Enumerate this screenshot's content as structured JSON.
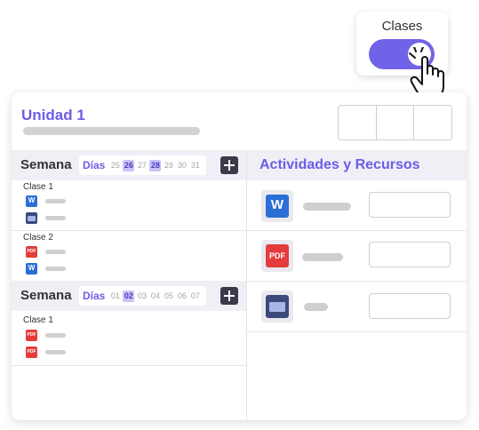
{
  "toggle": {
    "label": "Clases",
    "state": "on",
    "accent_color": "#7163e7"
  },
  "unit": {
    "title": "Unidad 1"
  },
  "weeks": [
    {
      "label": "Semana",
      "days_label": "Días",
      "days": [
        "25",
        "26",
        "27",
        "28",
        "29",
        "30",
        "31"
      ],
      "highlighted_days": [
        "26",
        "28"
      ],
      "classes": [
        {
          "label": "Clase 1",
          "resources": [
            "word-icon",
            "web-icon"
          ]
        },
        {
          "label": "Clase 2",
          "resources": [
            "pdf-icon",
            "word-icon"
          ]
        }
      ]
    },
    {
      "label": "Semana",
      "days_label": "Días",
      "days": [
        "01",
        "02",
        "03",
        "04",
        "05",
        "06",
        "07"
      ],
      "highlighted_days": [
        "02"
      ],
      "classes": [
        {
          "label": "Clase 1",
          "resources": [
            "pdf-icon",
            "pdf-icon"
          ]
        }
      ]
    }
  ],
  "activities": {
    "title": "Actividades y Recursos",
    "items": [
      {
        "icon": "word-icon",
        "icon_text": "W"
      },
      {
        "icon": "pdf-icon",
        "icon_text": "PDF"
      },
      {
        "icon": "web-icon",
        "icon_text": ""
      }
    ]
  },
  "icon_text": {
    "word": "W",
    "pdf": "PDF"
  },
  "colors": {
    "brand": "#6c5ce7",
    "word": "#2b6fd6",
    "pdf": "#e23c3c",
    "web": "#3b4a7a"
  }
}
